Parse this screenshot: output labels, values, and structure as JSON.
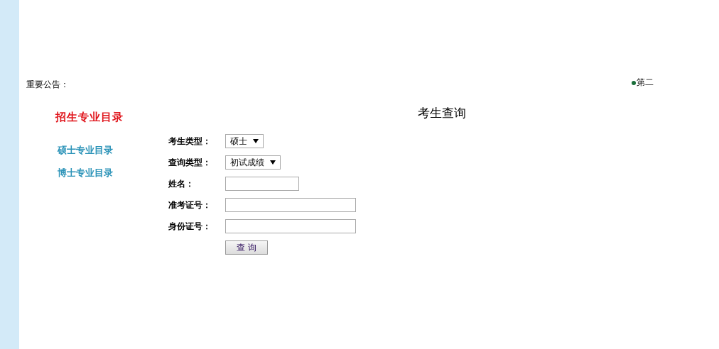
{
  "notice": {
    "label": "重要公告：",
    "ticker": "第二"
  },
  "sidebar": {
    "title": "招生专业目录",
    "links": [
      "硕士专业目录",
      "博士专业目录"
    ]
  },
  "form": {
    "title": "考生查询",
    "fields": [
      {
        "label": "考生类型：",
        "kind": "select",
        "value": "硕士"
      },
      {
        "label": "查询类型：",
        "kind": "select",
        "value": "初试成绩"
      },
      {
        "label": "姓名：",
        "kind": "short-text"
      },
      {
        "label": "准考证号：",
        "kind": "long-text"
      },
      {
        "label": "身份证号：",
        "kind": "long-text"
      }
    ],
    "submit": "查 询"
  }
}
